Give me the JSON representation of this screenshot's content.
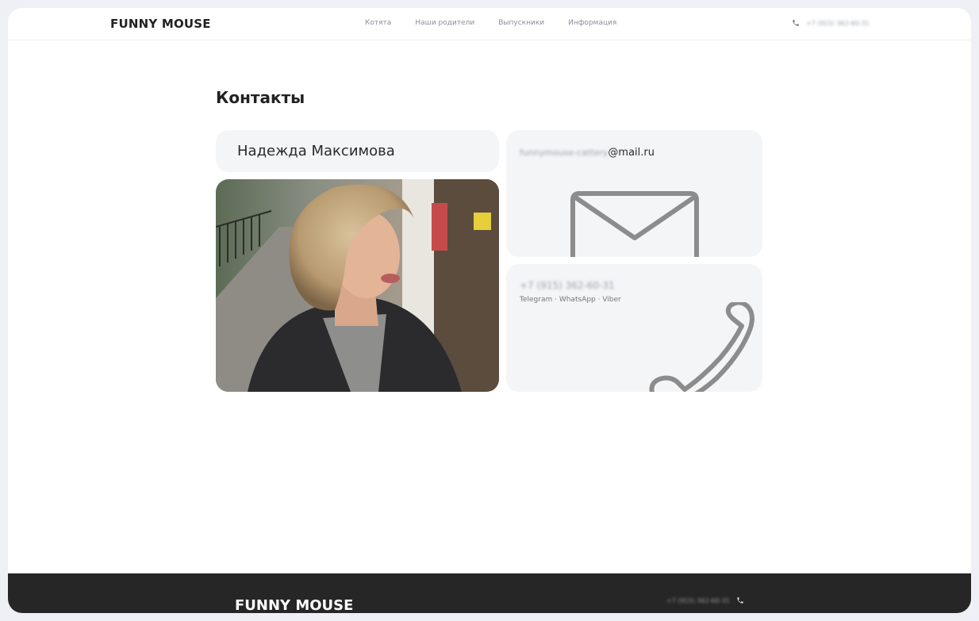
{
  "header": {
    "logo": "FUNNY MOUSE",
    "nav": [
      "Котята",
      "Наши родители",
      "Выпускники",
      "Информация"
    ],
    "phone": "+7 (915) 362-60-31",
    "phone_icon": "phone-icon"
  },
  "main": {
    "title": "Контакты",
    "contact_name": "Надежда Максимова",
    "email_user": "funnymouse-cattery",
    "email_domain": "@mail.ru",
    "email_icon": "envelope-icon",
    "phone": "+7 (915) 362-60-31",
    "messengers": "Telegram · WhatsApp · Viber",
    "phone_card_icon": "handset-icon"
  },
  "footer": {
    "logo": "FUNNY MOUSE",
    "phone": "+7 (915) 362-60-31",
    "phone_icon": "phone-icon"
  },
  "colors": {
    "card_bg": "#f4f5f7",
    "footer_bg": "#262626",
    "icon_gray": "#8c8c8c"
  }
}
